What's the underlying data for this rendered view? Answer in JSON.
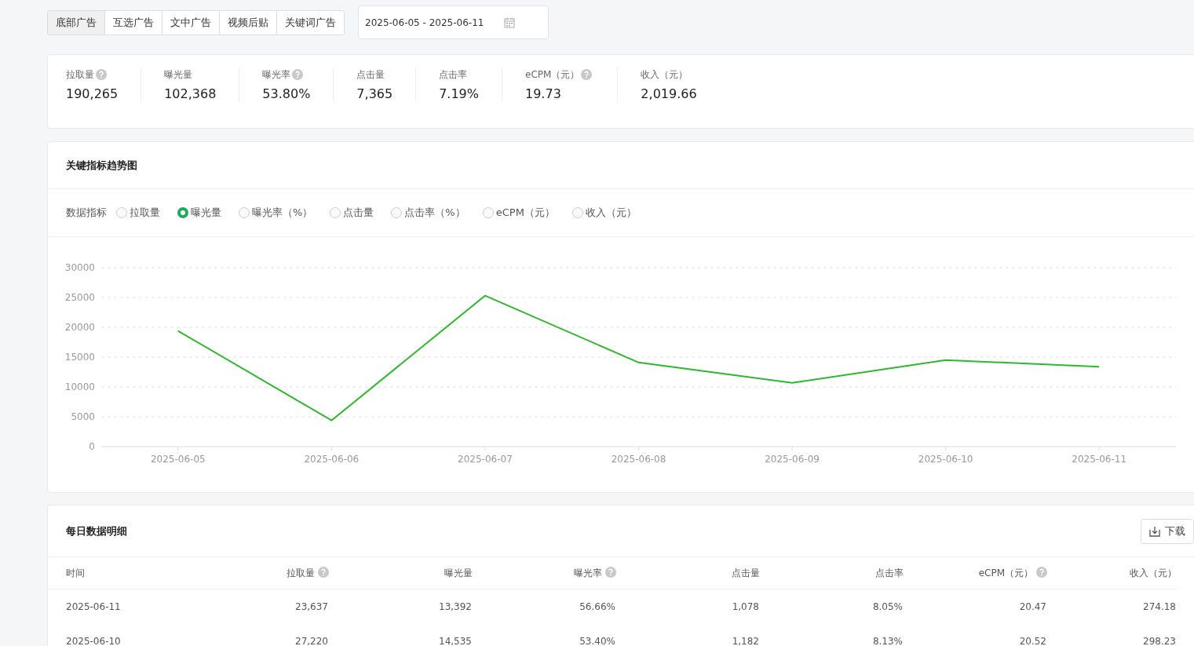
{
  "ad_tabs": [
    {
      "label": "底部广告",
      "selected": true
    },
    {
      "label": "互选广告",
      "selected": false
    },
    {
      "label": "文中广告",
      "selected": false
    },
    {
      "label": "视频后贴",
      "selected": false
    },
    {
      "label": "关键词广告",
      "selected": false
    }
  ],
  "date_range": {
    "value": "2025-06-05 - 2025-06-11"
  },
  "summary": [
    {
      "label": "拉取量",
      "kind": "help",
      "value": "190,265"
    },
    {
      "label": "曝光量",
      "kind": "plain",
      "value": "102,368"
    },
    {
      "label": "曝光率",
      "kind": "help",
      "value": "53.80%"
    },
    {
      "label": "点击量",
      "kind": "plain",
      "value": "7,365"
    },
    {
      "label": "点击率",
      "kind": "plain",
      "value": "7.19%"
    },
    {
      "label": "eCPM（元）",
      "kind": "help",
      "value": "19.73"
    },
    {
      "label": "收入（元）",
      "kind": "plain",
      "value": "2,019.66"
    }
  ],
  "trend": {
    "title": "关键指标趋势图",
    "metric_label": "数据指标",
    "metrics": [
      {
        "label": "拉取量",
        "selected": false
      },
      {
        "label": "曝光量",
        "selected": true
      },
      {
        "label": "曝光率（%）",
        "selected": false
      },
      {
        "label": "点击量",
        "selected": false
      },
      {
        "label": "点击率（%）",
        "selected": false
      },
      {
        "label": "eCPM（元）",
        "selected": false
      },
      {
        "label": "收入（元）",
        "selected": false
      }
    ],
    "chart_data": {
      "type": "line",
      "categories": [
        "2025-06-05",
        "2025-06-06",
        "2025-06-07",
        "2025-06-08",
        "2025-06-09",
        "2025-06-10",
        "2025-06-11"
      ],
      "series": [
        {
          "color": "#2eb82e",
          "values": [
            19400,
            4400,
            25300,
            14100,
            10700,
            14500,
            13400
          ]
        }
      ],
      "ylim": [
        0,
        30000
      ],
      "grid": true,
      "yticks": [
        0,
        5000,
        10000,
        15000,
        20000,
        25000,
        30000
      ]
    }
  },
  "daily": {
    "title": "每日数据明细",
    "download": "下载",
    "columns": [
      {
        "label": "时间",
        "kind": "plain"
      },
      {
        "label": "拉取量",
        "kind": "help"
      },
      {
        "label": "曝光量",
        "kind": "plain"
      },
      {
        "label": "曝光率",
        "kind": "help"
      },
      {
        "label": "点击量",
        "kind": "plain"
      },
      {
        "label": "点击率",
        "kind": "plain"
      },
      {
        "label": "eCPM（元）",
        "kind": "help"
      },
      {
        "label": "收入（元）",
        "kind": "plain"
      }
    ],
    "rows": [
      [
        "2025-06-11",
        "23,637",
        "13,392",
        "56.66%",
        "1,078",
        "8.05%",
        "20.47",
        "274.18"
      ],
      [
        "2025-06-10",
        "27,220",
        "14,535",
        "53.40%",
        "1,182",
        "8.13%",
        "20.52",
        "298.23"
      ]
    ]
  }
}
